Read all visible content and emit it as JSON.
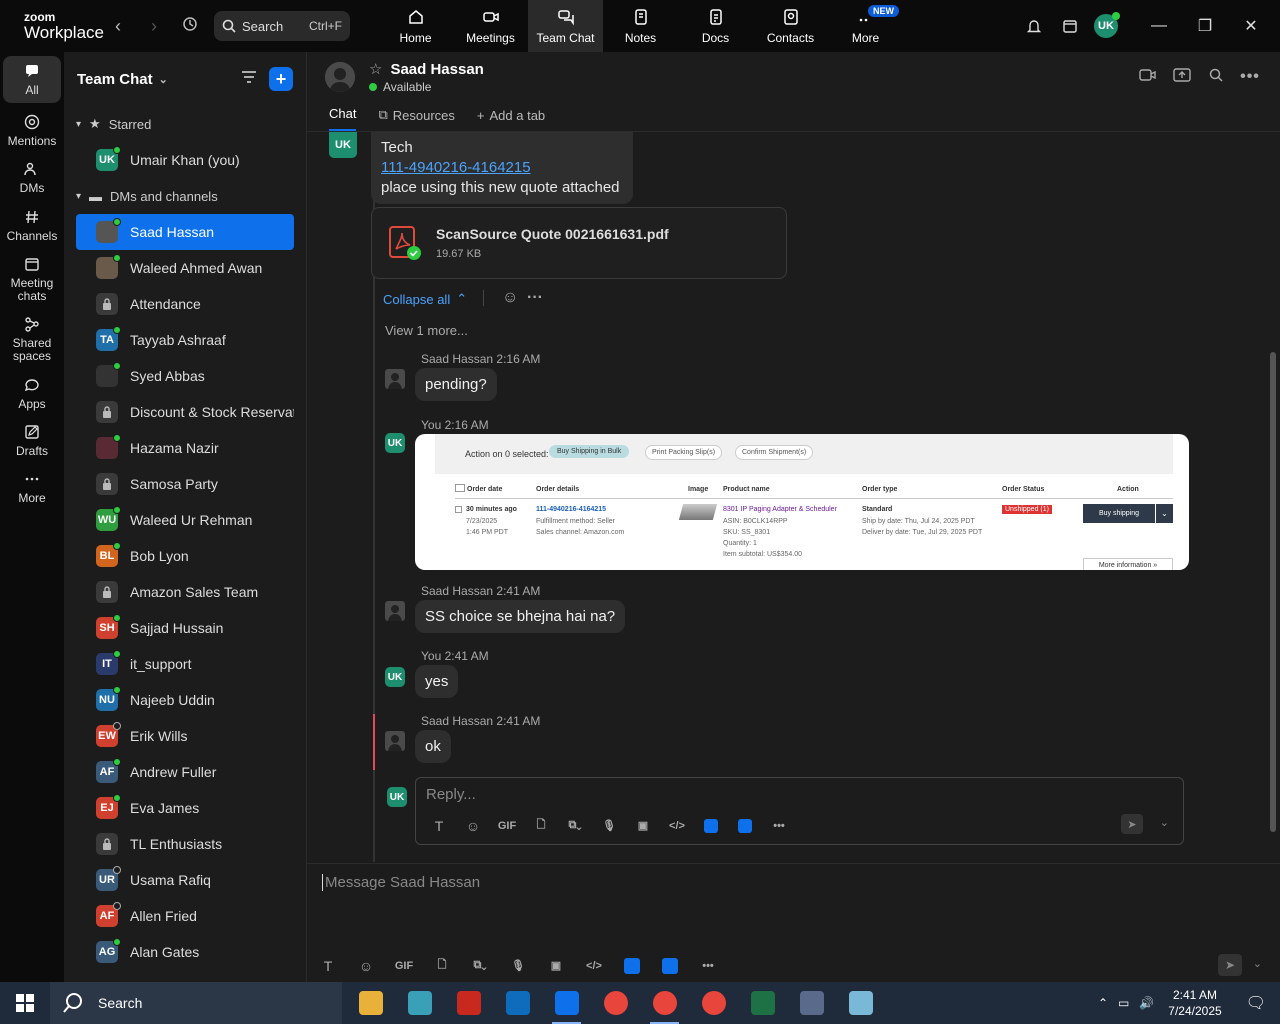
{
  "app": {
    "brand_top": "zoom",
    "brand_bottom": "Workplace"
  },
  "search": {
    "label": "Search",
    "shortcut": "Ctrl+F"
  },
  "top_tabs": [
    {
      "label": "Home",
      "icon": "home-icon"
    },
    {
      "label": "Meetings",
      "icon": "video-icon"
    },
    {
      "label": "Team Chat",
      "icon": "chat-icon"
    },
    {
      "label": "Notes",
      "icon": "notes-icon"
    },
    {
      "label": "Docs",
      "icon": "docs-icon"
    },
    {
      "label": "Contacts",
      "icon": "contacts-icon"
    },
    {
      "label": "More",
      "icon": "more-icon",
      "badge": "NEW"
    }
  ],
  "user_initials": "UK",
  "rail": [
    {
      "label": "All"
    },
    {
      "label": "Mentions"
    },
    {
      "label": "DMs"
    },
    {
      "label": "Channels"
    },
    {
      "label": "Meeting chats"
    },
    {
      "label": "Shared spaces"
    },
    {
      "label": "Apps"
    },
    {
      "label": "Drafts"
    },
    {
      "label": "More"
    }
  ],
  "sidebar": {
    "title": "Team Chat",
    "starred_label": "Starred",
    "starred": [
      {
        "name": "Umair Khan (you)",
        "initials": "UK",
        "color": "#1e8f6e",
        "status": "online"
      }
    ],
    "dms_label": "DMs and channels",
    "items": [
      {
        "name": "Saad Hassan",
        "initials": "",
        "color": "#555555",
        "status": "online",
        "selected": true
      },
      {
        "name": "Waleed Ahmed Awan",
        "initials": "",
        "color": "#6a5a4a",
        "status": "online"
      },
      {
        "name": "Attendance",
        "initials": "",
        "color": "#3a3a3a",
        "status": "lock"
      },
      {
        "name": "Tayyab Ashraaf",
        "initials": "TA",
        "color": "#1f6fa8",
        "status": "online"
      },
      {
        "name": "Syed Abbas",
        "initials": "",
        "color": "#333333",
        "status": "online"
      },
      {
        "name": "Discount & Stock Reservati...",
        "initials": "",
        "color": "#3a3a3a",
        "status": "lock"
      },
      {
        "name": "Hazama Nazir",
        "initials": "",
        "color": "#5a2a34",
        "status": "online"
      },
      {
        "name": "Samosa Party",
        "initials": "",
        "color": "#3a3a3a",
        "status": "lock"
      },
      {
        "name": "Waleed Ur Rehman",
        "initials": "WU",
        "color": "#2e9e3e",
        "status": "online"
      },
      {
        "name": "Bob Lyon",
        "initials": "BL",
        "color": "#d2651e",
        "status": "online"
      },
      {
        "name": "Amazon Sales Team",
        "initials": "",
        "color": "#3a3a3a",
        "status": "lock"
      },
      {
        "name": "Sajjad Hussain",
        "initials": "SH",
        "color": "#d0402e",
        "status": "online"
      },
      {
        "name": "it_support",
        "initials": "IT",
        "color": "#2a3a6a",
        "status": "online"
      },
      {
        "name": "Najeeb Uddin",
        "initials": "NU",
        "color": "#1f6fa8",
        "status": "online"
      },
      {
        "name": "Erik Wills",
        "initials": "EW",
        "color": "#d0402e",
        "status": "away"
      },
      {
        "name": "Andrew Fuller",
        "initials": "AF",
        "color": "#3a5a7a",
        "status": "online"
      },
      {
        "name": "Eva James",
        "initials": "EJ",
        "color": "#d0402e",
        "status": "online"
      },
      {
        "name": "TL Enthusiasts",
        "initials": "",
        "color": "#3a3a3a",
        "status": "lock"
      },
      {
        "name": "Usama Rafiq",
        "initials": "UR",
        "color": "#3a5a7a",
        "status": "offline"
      },
      {
        "name": "Allen Fried",
        "initials": "AF",
        "color": "#d0402e",
        "status": "offline"
      },
      {
        "name": "Alan Gates",
        "initials": "AG",
        "color": "#3a5a7a",
        "status": "online"
      }
    ]
  },
  "chat": {
    "contact_name": "Saad Hassan",
    "status": "Available",
    "tabs": [
      "Chat",
      "Resources",
      "Add a tab"
    ],
    "thread_msg_lines": [
      "Tech",
      "111-4940216-4164215",
      "place using this new quote attached"
    ],
    "thread_initials": "UK",
    "attachment": {
      "name": "ScanSource Quote 0021661631.pdf",
      "size": "19.67 KB"
    },
    "collapse_label": "Collapse all",
    "view_more": "View 1 more...",
    "messages": [
      {
        "sender": "Saad Hassan",
        "time": "2:16 AM",
        "text": "pending?"
      },
      {
        "sender": "You",
        "time": "2:16 AM",
        "text": ""
      },
      {
        "sender": "Saad Hassan",
        "time": "2:41 AM",
        "text": "SS choice se bhejna hai na?"
      },
      {
        "sender": "You",
        "time": "2:41 AM",
        "text": "yes"
      },
      {
        "sender": "Saad Hassan",
        "time": "2:41 AM",
        "text": "ok"
      }
    ],
    "reply_placeholder": "Reply...",
    "composer_placeholder": "Message Saad Hassan",
    "gif_label": "GIF"
  },
  "screenshot_image": {
    "action_label": "Action on 0 selected:",
    "btn1": "Buy Shipping in Bulk",
    "btn2": "Print Packing Slip(s)",
    "btn3": "Confirm Shipment(s)",
    "headers": [
      "Order date",
      "Order details",
      "Image",
      "Product name",
      "Order type",
      "Order Status",
      "Action"
    ],
    "order_age": "30 minutes ago",
    "order_date": "7/23/2025",
    "order_time": "1:46 PM PDT",
    "order_id": "111-4940216-4164215",
    "fulfill": "Fulfillment method: Seller",
    "channel": "Sales channel: Amazon.com",
    "product": "8301 IP Paging Adapter & Scheduler",
    "asin": "ASIN: B0CLK14RPP",
    "sku": "SKU: SS_8301",
    "qty": "Quantity: 1",
    "subtotal": "Item subtotal: US$354.00",
    "order_type": "Standard",
    "ship_by": "Ship by date: Thu, Jul 24, 2025 PDT",
    "deliver_by": "Deliver by date: Tue, Jul 29, 2025 PDT",
    "status": "Unshipped (1)",
    "action_btn": "Buy shipping",
    "more_info": "More information »"
  },
  "taskbar": {
    "search_label": "Search",
    "time": "2:41 AM",
    "date": "7/24/2025",
    "apps": [
      {
        "name": "file-explorer",
        "color": "#e8b13a"
      },
      {
        "name": "app-diamond",
        "color": "#3aa0b8"
      },
      {
        "name": "filezilla",
        "color": "#c8281e"
      },
      {
        "name": "outlook",
        "color": "#0f6cbd"
      },
      {
        "name": "zoom",
        "color": "#0e71eb"
      },
      {
        "name": "chrome-1",
        "color": "#e8453c"
      },
      {
        "name": "chrome-2",
        "color": "#e8453c"
      },
      {
        "name": "chrome-3",
        "color": "#e8453c"
      },
      {
        "name": "excel",
        "color": "#1e7145"
      },
      {
        "name": "calculator",
        "color": "#5a6a8a"
      },
      {
        "name": "notepad",
        "color": "#7ab8d8"
      }
    ]
  }
}
